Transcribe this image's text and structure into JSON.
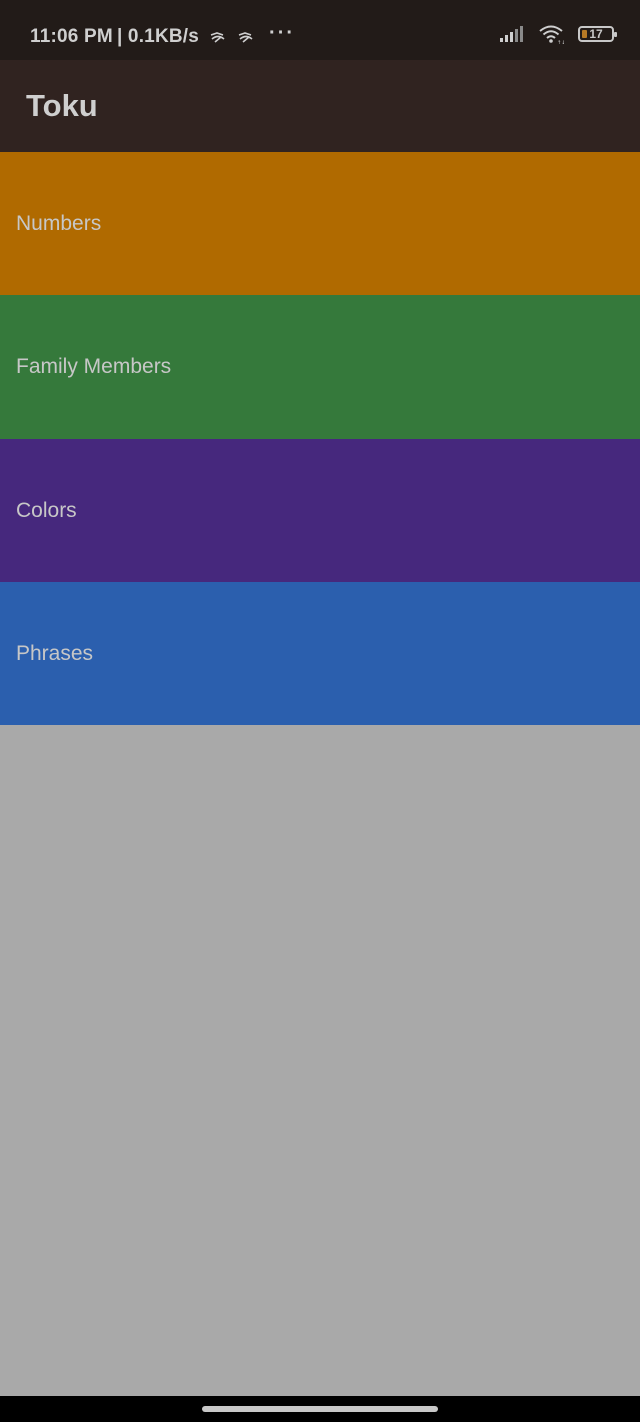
{
  "status_bar": {
    "time": "11:06 PM",
    "network_speed": "| 0.1KB/s",
    "more_dots": "···",
    "battery_level": "17",
    "icons": [
      "notification-app-icon",
      "notification-app-icon",
      "signal-icon",
      "wifi-icon",
      "battery-icon"
    ]
  },
  "app_bar": {
    "title": "Toku"
  },
  "categories": [
    {
      "label": "Numbers",
      "color": "#b06a00"
    },
    {
      "label": "Family Members",
      "color": "#35793b"
    },
    {
      "label": "Colors",
      "color": "#46287d"
    },
    {
      "label": "Phrases",
      "color": "#2b5fae"
    }
  ],
  "colors": {
    "status_bar_bg": "#221b18",
    "app_bar_bg": "#302320",
    "body_bg": "#a9a9a9",
    "nav_bar_bg": "#000000"
  }
}
